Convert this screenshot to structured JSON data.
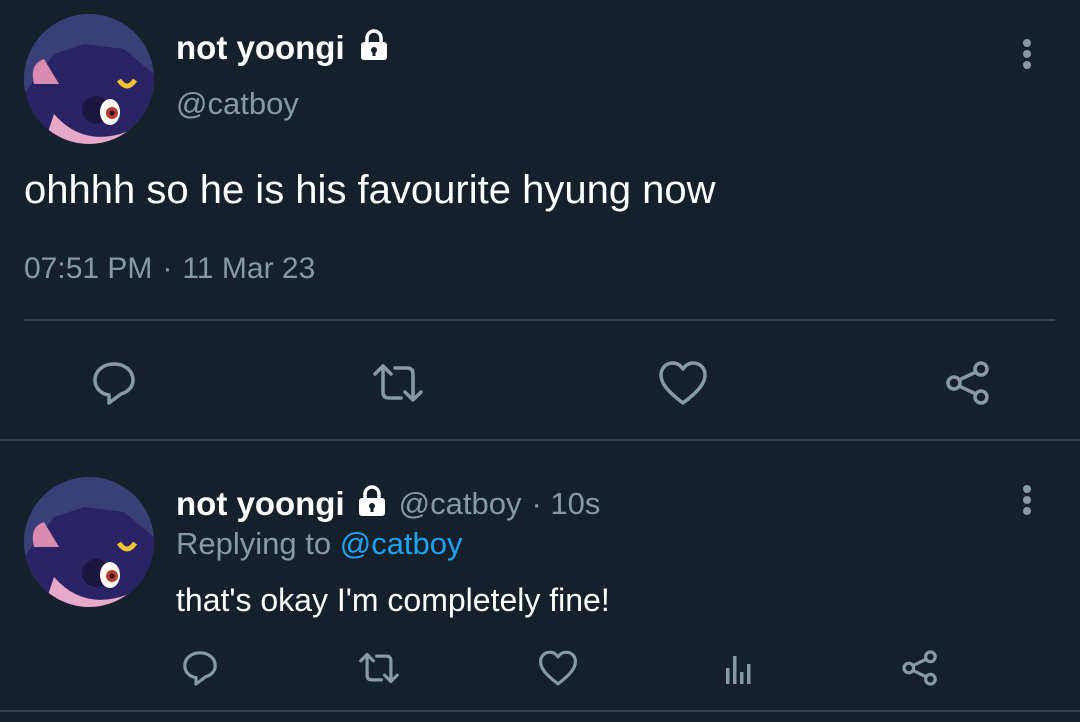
{
  "main_tweet": {
    "display_name": "not yoongi",
    "handle": "@catboy",
    "text": "ohhhh so he is his favourite hyung now",
    "time": "07:51 PM",
    "separator": "·",
    "date": "11 Mar 23"
  },
  "reply_tweet": {
    "display_name": "not yoongi",
    "handle": "@catboy",
    "age": "· 10s",
    "replying_to_label": "Replying to",
    "replying_to_handle": "@catboy",
    "text": "that's okay I'm completely fine!"
  },
  "colors": {
    "background": "#15202b",
    "secondary_text": "#8899a6",
    "link": "#1da1f2",
    "divider": "#38444d"
  },
  "icons": [
    "lock-icon",
    "more-options-icon",
    "reply-icon",
    "retweet-icon",
    "like-icon",
    "share-icon",
    "analytics-icon"
  ]
}
